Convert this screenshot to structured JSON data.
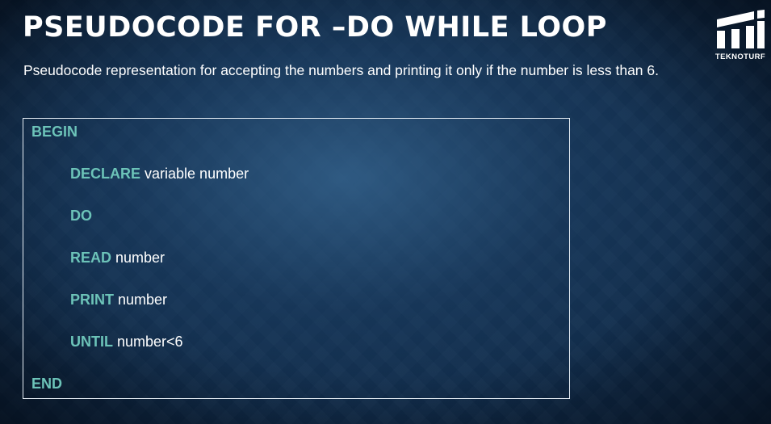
{
  "title": "PSEUDOCODE FOR –DO WHILE LOOP",
  "subtitle": "Pseudocode representation for accepting the numbers and printing it only if the number is less than 6.",
  "logo": {
    "text": "TEKNOTURF",
    "icon": "teknoturf-logo-icon"
  },
  "code": {
    "lines": [
      {
        "keyword": "BEGIN",
        "rest": ""
      },
      {
        "keyword": "DECLARE",
        "rest": " variable number"
      },
      {
        "keyword": "DO",
        "rest": ""
      },
      {
        "keyword": "READ",
        "rest": " number"
      },
      {
        "keyword": "PRINT",
        "rest": " number"
      },
      {
        "keyword": "UNTIL",
        "rest": " number<6"
      },
      {
        "keyword": "END",
        "rest": ""
      }
    ]
  },
  "colors": {
    "keyword": "#6cc3b8",
    "text": "#ffffff",
    "background": "#0f2a47"
  }
}
